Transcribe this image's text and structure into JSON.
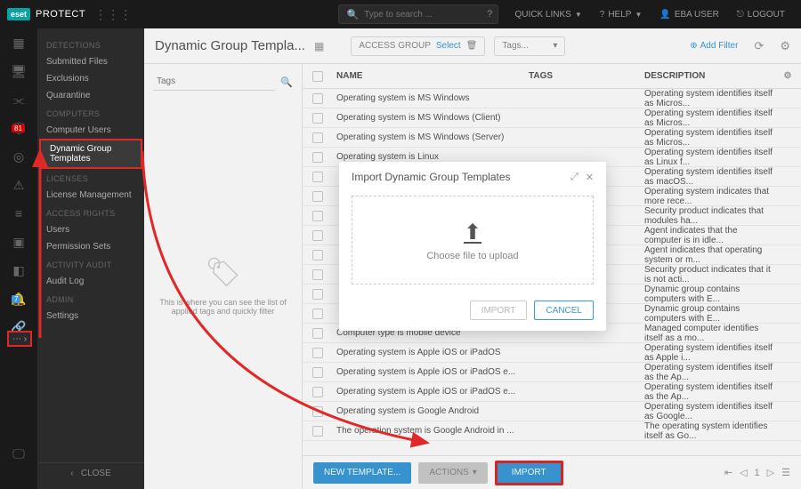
{
  "brand": {
    "badge": "eset",
    "name": "PROTECT"
  },
  "topbar": {
    "search_placeholder": "Type to search ...",
    "quick_links": "QUICK LINKS",
    "help": "HELP",
    "user": "EBA USER",
    "logout": "LOGOUT"
  },
  "iconbar": {
    "badge1": "81",
    "badge2": "7"
  },
  "nav": {
    "sections": [
      {
        "title": "DETECTIONS",
        "items": [
          "Submitted Files",
          "Exclusions",
          "Quarantine"
        ]
      },
      {
        "title": "COMPUTERS",
        "items": [
          "Computer Users",
          "Dynamic Group Templates"
        ]
      },
      {
        "title": "LICENSES",
        "items": [
          "License Management"
        ]
      },
      {
        "title": "ACCESS RIGHTS",
        "items": [
          "Users",
          "Permission Sets"
        ]
      },
      {
        "title": "ACTIVITY AUDIT",
        "items": [
          "Audit Log"
        ]
      },
      {
        "title": "ADMIN",
        "items": [
          "Settings"
        ]
      }
    ],
    "selected": "Dynamic Group Templates",
    "close": "CLOSE"
  },
  "header": {
    "title": "Dynamic Group Templa...",
    "access_group": "ACCESS GROUP",
    "select": "Select",
    "tags": "Tags...",
    "add_filter": "Add Filter"
  },
  "tags": {
    "search": "Tags",
    "empty": "This is where you can see the list of applied tags and quickly filter"
  },
  "table": {
    "cols": {
      "name": "NAME",
      "tags": "TAGS",
      "desc": "DESCRIPTION"
    },
    "rows": [
      {
        "name": "Operating system is MS Windows",
        "desc": "Operating system identifies itself as Micros..."
      },
      {
        "name": "Operating system is MS Windows (Client)",
        "desc": "Operating system identifies itself as Micros..."
      },
      {
        "name": "Operating system is MS Windows (Server)",
        "desc": "Operating system identifies itself as Micros..."
      },
      {
        "name": "Operating system is Linux",
        "desc": "Operating system identifies itself as Linux f..."
      },
      {
        "name": "",
        "desc": "Operating system identifies itself as macOS..."
      },
      {
        "name": "",
        "desc": "Operating system indicates that more rece..."
      },
      {
        "name": "",
        "desc": "Security product indicates that modules ha..."
      },
      {
        "name": "",
        "desc": "Agent indicates that the computer is in idle..."
      },
      {
        "name": "",
        "desc": "Agent indicates that operating system or m..."
      },
      {
        "name": "",
        "desc": "Security product indicates that it is not acti..."
      },
      {
        "name": "",
        "desc": "Dynamic group contains computers with E..."
      },
      {
        "name": "",
        "desc": "Dynamic group contains computers with E..."
      },
      {
        "name": "Computer type is mobile device",
        "desc": "Managed computer identifies itself as a mo..."
      },
      {
        "name": "Operating system is Apple iOS or iPadOS",
        "desc": "Operating system identifies itself as Apple i..."
      },
      {
        "name": "Operating system is Apple iOS or iPadOS e...",
        "desc": "Operating system identifies itself as the Ap..."
      },
      {
        "name": "Operating system is Apple iOS or iPadOS e...",
        "desc": "Operating system identifies itself as the Ap..."
      },
      {
        "name": "Operating system is Google Android",
        "desc": "Operating system identifies itself as Google..."
      },
      {
        "name": "The operation system is Google Android in ...",
        "desc": "The operating system identifies itself as Go..."
      }
    ]
  },
  "footer": {
    "new_template": "NEW TEMPLATE...",
    "actions": "ACTIONS",
    "import": "IMPORT",
    "page": "1"
  },
  "modal": {
    "title": "Import Dynamic Group Templates",
    "choose": "Choose file to upload",
    "import": "IMPORT",
    "cancel": "CANCEL"
  }
}
